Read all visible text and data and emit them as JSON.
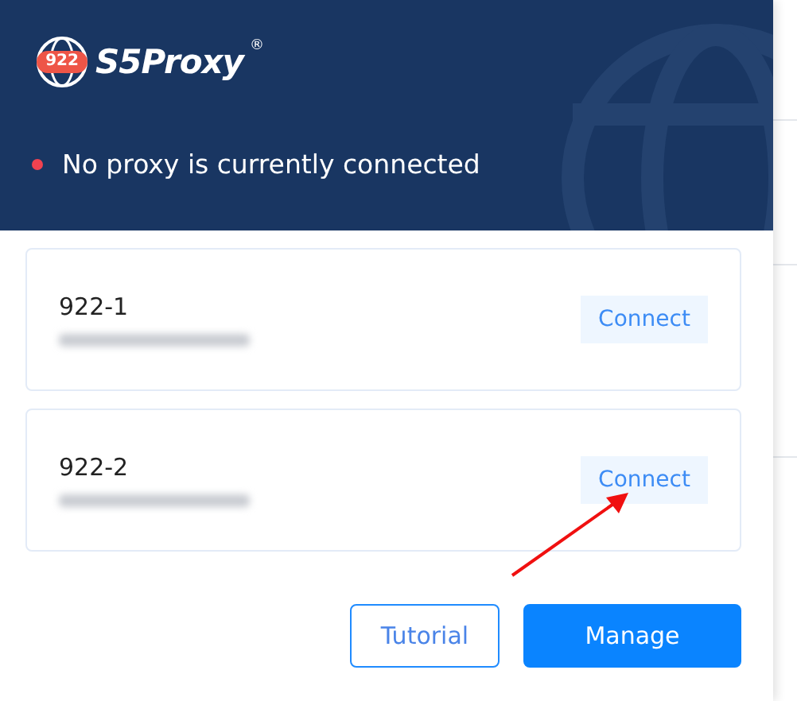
{
  "header": {
    "logo_badge": "922",
    "logo_text": "S5Proxy",
    "logo_mark": "®"
  },
  "status": {
    "connected": false,
    "text": "No proxy is currently connected"
  },
  "proxies": [
    {
      "name": "922-1",
      "button": "Connect",
      "pointed": false
    },
    {
      "name": "922-2",
      "button": "Connect",
      "pointed": true
    }
  ],
  "buttons": [
    {
      "label": "Tutorial",
      "kind": "outline"
    },
    {
      "label": "Manage",
      "kind": "primary"
    }
  ]
}
